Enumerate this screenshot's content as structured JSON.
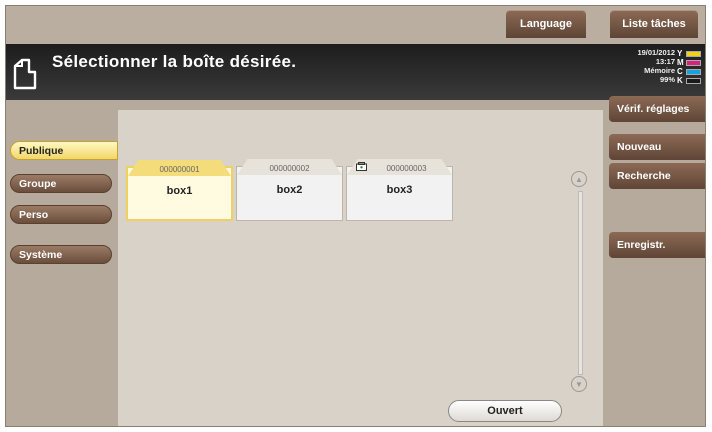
{
  "topbar": {
    "language_label": "Language",
    "jobs_label": "Liste tâches"
  },
  "header": {
    "title": "Sélectionner la boîte désirée.",
    "date": "19/01/2012",
    "time": "13:17",
    "memory_label": "Mémoire",
    "memory_value": "99%"
  },
  "toner": [
    {
      "letter": "Y",
      "color": "#f1d21a"
    },
    {
      "letter": "M",
      "color": "#d8237a"
    },
    {
      "letter": "C",
      "color": "#1aa0e0"
    },
    {
      "letter": "K",
      "color": "#1a1a1a"
    }
  ],
  "tabs": [
    {
      "label": "Publique",
      "active": true
    },
    {
      "label": "Groupe",
      "active": false
    },
    {
      "label": "Perso",
      "active": false
    },
    {
      "label": "Système",
      "active": false
    }
  ],
  "boxes": [
    {
      "number": "000000001",
      "name": "box1",
      "selected": true,
      "locked": false
    },
    {
      "number": "000000002",
      "name": "box2",
      "selected": false,
      "locked": false
    },
    {
      "number": "000000003",
      "name": "box3",
      "selected": false,
      "locked": true
    }
  ],
  "right_buttons": {
    "verify": "Vérif. réglages",
    "new": "Nouveau",
    "search": "Recherche",
    "register": "Enregistr."
  },
  "ouvert_label": "Ouvert",
  "colors": {
    "selected_tab": "#f2d66a",
    "button_brown": "#6a4e3c",
    "header_bg": "#1d1d1d"
  }
}
